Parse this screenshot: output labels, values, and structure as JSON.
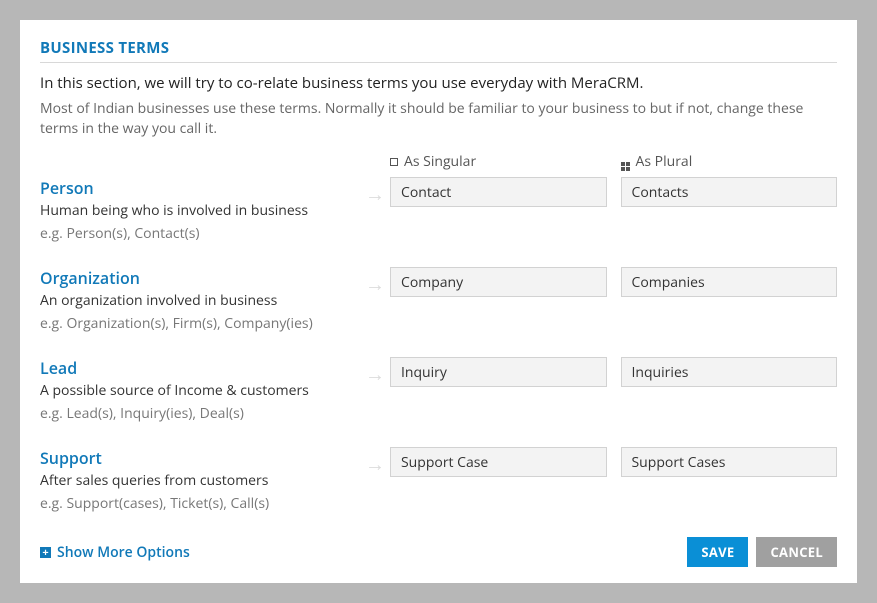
{
  "section_title": "BUSINESS TERMS",
  "intro": "In this section, we will try to co-relate business terms you use everyday with MeraCRM.",
  "subintro": "Most of Indian businesses use these terms. Normally it should be familiar to your business to but if not, change these terms in the way you call it.",
  "headers": {
    "singular": "As Singular",
    "plural": "As Plural"
  },
  "terms": [
    {
      "label": "Person",
      "desc": "Human being who is involved in business",
      "example": "e.g. Person(s), Contact(s)",
      "singular": "Contact",
      "plural": "Contacts"
    },
    {
      "label": "Organization",
      "desc": "An organization involved in business",
      "example": "e.g. Organization(s), Firm(s), Company(ies)",
      "singular": "Company",
      "plural": "Companies"
    },
    {
      "label": "Lead",
      "desc": "A possible source of Income & customers",
      "example": "e.g. Lead(s), Inquiry(ies), Deal(s)",
      "singular": "Inquiry",
      "plural": "Inquiries"
    },
    {
      "label": "Support",
      "desc": "After sales queries from customers",
      "example": "e.g. Support(cases), Ticket(s), Call(s)",
      "singular": "Support Case",
      "plural": "Support Cases"
    }
  ],
  "show_more": "Show More Options",
  "buttons": {
    "save": "SAVE",
    "cancel": "CANCEL"
  }
}
